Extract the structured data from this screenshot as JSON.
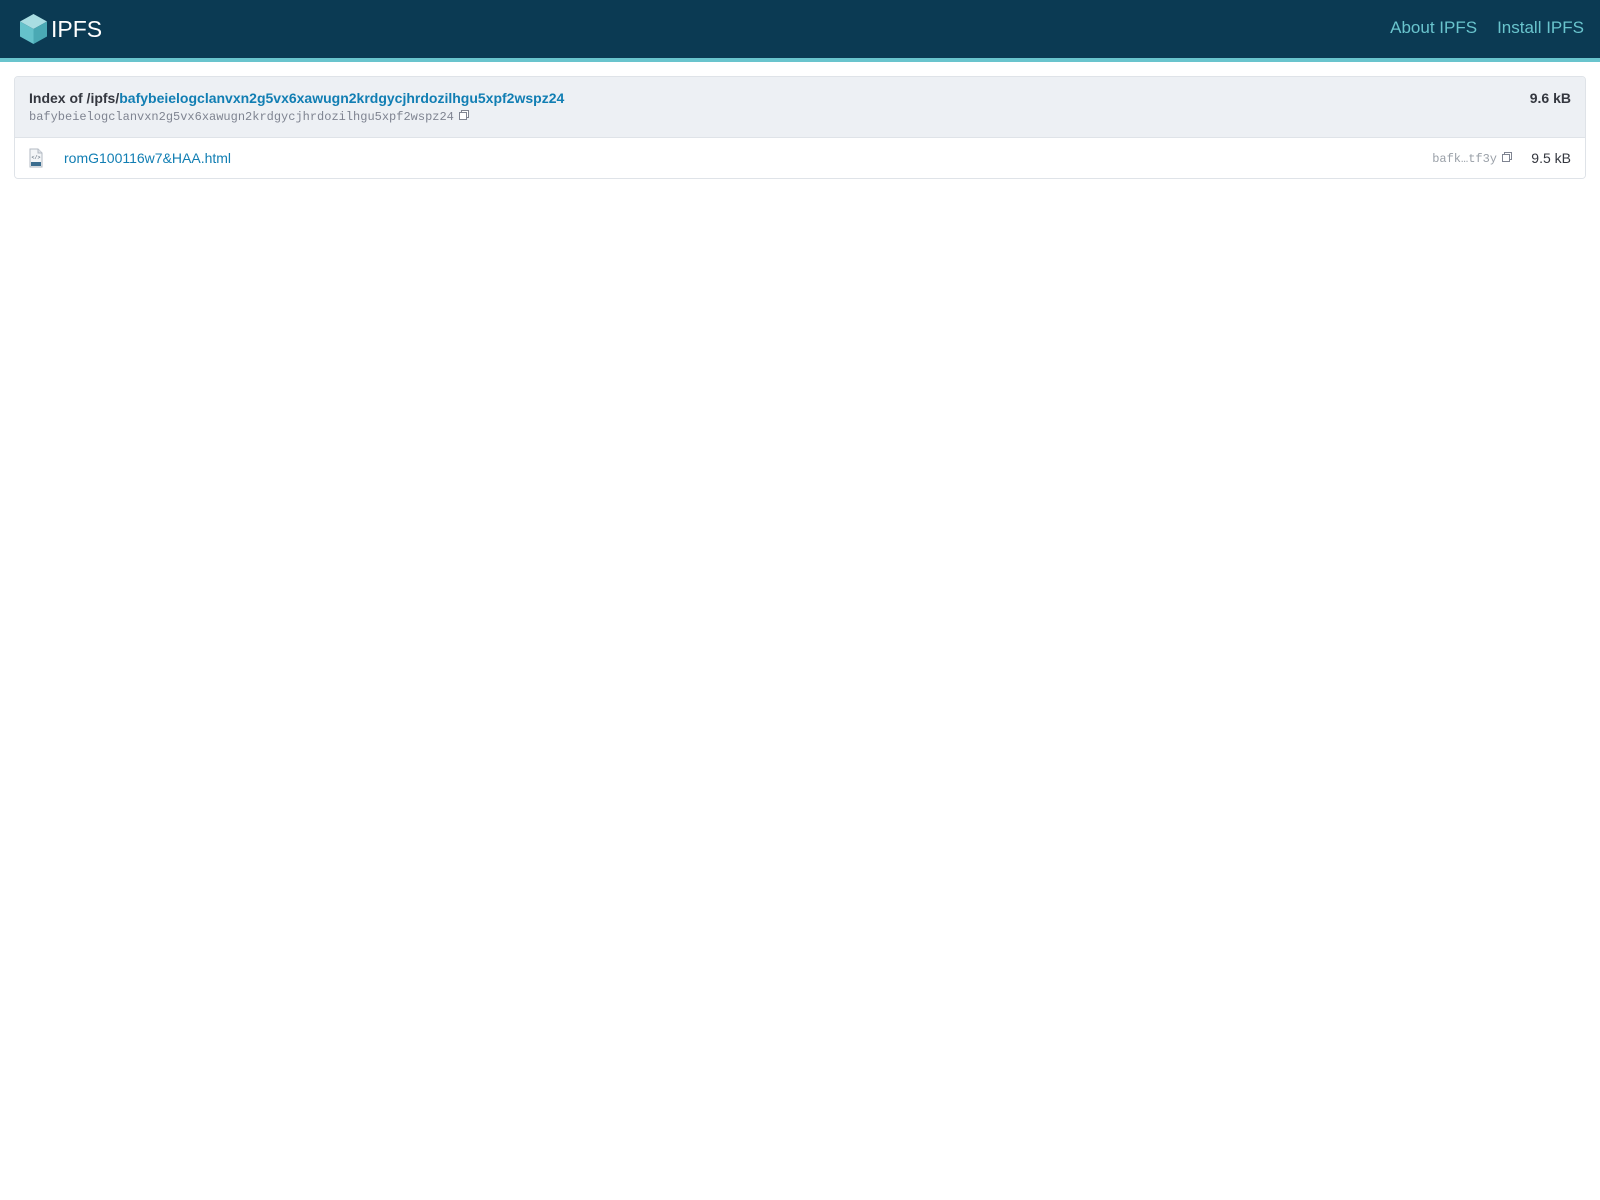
{
  "header": {
    "logo_text": "IPFS",
    "nav": [
      {
        "label": "About IPFS"
      },
      {
        "label": "Install IPFS"
      }
    ]
  },
  "listing": {
    "title_prefix": "Index of /ipfs/",
    "title_cid": "bafybeielogclanvxn2g5vx6xawugn2krdgycjhrdozilhgu5xpf2wspz24",
    "root_cid": "bafybeielogclanvxn2g5vx6xawugn2krdgycjhrdozilhgu5xpf2wspz24",
    "total_size": "9.6 kB",
    "files": [
      {
        "name": "romG100116w7&HAA.html",
        "cid_short": "bafk…tf3y",
        "size": "9.5 kB",
        "icon": "html-file-icon"
      }
    ]
  },
  "colors": {
    "header_bg": "#0b3a53",
    "accent": "#69c4cd",
    "link": "#117eb3",
    "head_bg": "#edf0f4"
  }
}
